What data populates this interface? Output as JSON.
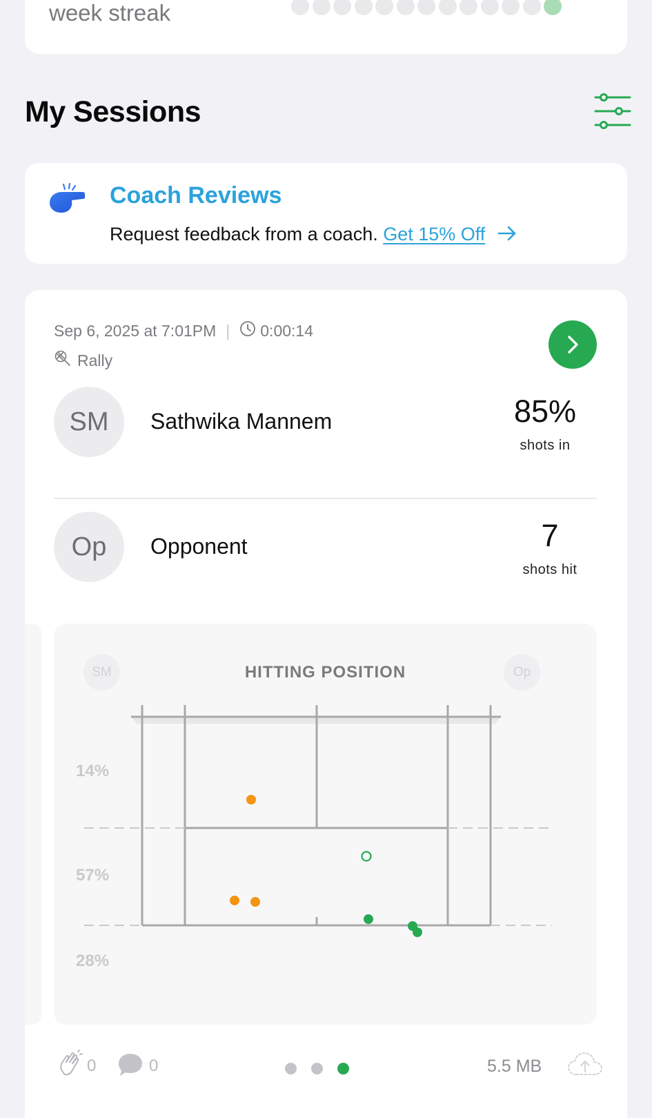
{
  "streak": {
    "label": "week streak",
    "colors": {
      "dot_off": "#e9e9ec",
      "dot_on": "#a9dcb5"
    }
  },
  "sessions": {
    "title": "My Sessions",
    "filter_icon": "sliders-icon"
  },
  "coach": {
    "icon": "whistle-icon",
    "title": "Coach Reviews",
    "text": "Request feedback from a coach.",
    "link": "Get 15% Off",
    "link_icon": "arrow-right-icon"
  },
  "session": {
    "date": "Sep 6, 2025 at 7:01PM",
    "separator": "|",
    "duration": "0:00:14",
    "type": "Rally",
    "players": [
      {
        "initials": "SM",
        "name": "Sathwika Mannem",
        "stat_value": "85%",
        "stat_label": "shots in"
      },
      {
        "initials": "Op",
        "name": "Opponent",
        "stat_value": "7",
        "stat_label": "shots hit"
      }
    ],
    "hitting": {
      "title": "HITTING POSITION",
      "left_initials": "SM",
      "right_initials": "Op",
      "zones": [
        "14%",
        "57%",
        "28%"
      ],
      "colors": {
        "player": "#f59412",
        "opponent": "#27a952",
        "lines": "#a8a8ab"
      }
    },
    "footer": {
      "claps": "0",
      "comments": "0",
      "pages": 3,
      "active_page": 3,
      "file_size": "5.5 MB"
    }
  }
}
